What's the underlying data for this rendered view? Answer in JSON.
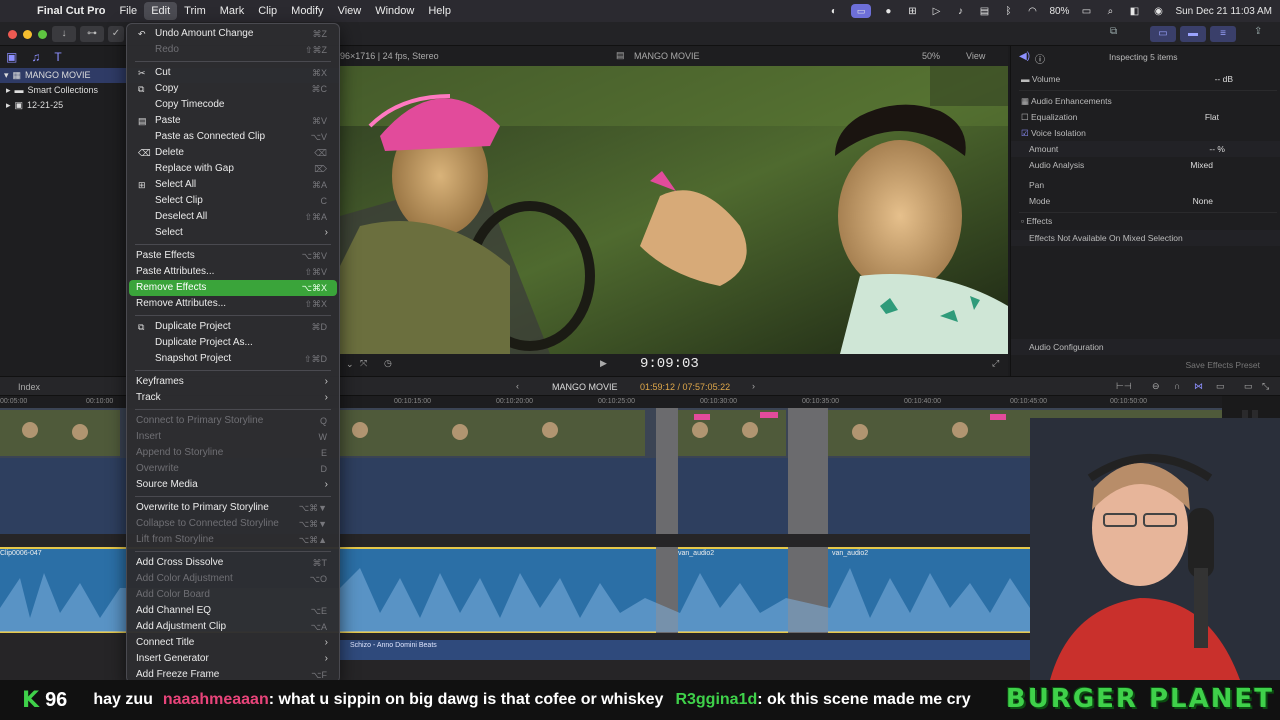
{
  "menubar": {
    "app": "Final Cut Pro",
    "items": [
      "File",
      "Edit",
      "Trim",
      "Mark",
      "Clip",
      "Modify",
      "View",
      "Window",
      "Help"
    ],
    "active_item": "Edit",
    "battery": "80%",
    "datetime": "Sun Dec 21  11:03 AM"
  },
  "browser": {
    "library": "MANGO MOVIE",
    "items": [
      "Smart Collections",
      "12-21-25"
    ]
  },
  "viewer": {
    "format": "96×1716 | 24 fps, Stereo",
    "project": "MANGO MOVIE",
    "zoom": "50%",
    "view": "View",
    "timecode": "9:09:03"
  },
  "inspector": {
    "title": "Inspecting 5 items",
    "volume_label": "Volume",
    "volume_value": "-- dB",
    "enhancements": "Audio Enhancements",
    "equalization": "Equalization",
    "equalization_value": "Flat",
    "voice_isolation": "Voice Isolation",
    "amount": "Amount",
    "amount_value": "-- %",
    "analysis": "Audio Analysis",
    "analysis_value": "Mixed",
    "pan": "Pan",
    "mode": "Mode",
    "mode_value": "None",
    "effects": "Effects",
    "effects_note": "Effects Not Available On Mixed Selection",
    "audio_config": "Audio Configuration",
    "save_preset": "Save Effects Preset"
  },
  "timeline": {
    "index": "Index",
    "project": "MANGO MOVIE",
    "timecode": "01:59:12 / 07:57:05:22",
    "ruler": [
      "00:05:00",
      "00:10:00",
      "00:10:15:00",
      "00:10:20:00",
      "00:10:25:00",
      "00:10:30:00",
      "00:10:35:00",
      "00:10:40:00",
      "00:10:45:00",
      "00:10:50:00"
    ],
    "clip_left": "Clip0006-047",
    "clip_a": "van_audio2",
    "clip_b": "van_audio2",
    "music": "Schizo - Anno Domini Beats"
  },
  "edit_menu": {
    "groups": [
      [
        {
          "label": "Undo Amount Change",
          "shortcut": "⌘Z",
          "icon": "undo",
          "disabled": false
        },
        {
          "label": "Redo",
          "shortcut": "⇧⌘Z",
          "icon": "",
          "disabled": true
        }
      ],
      [
        {
          "label": "Cut",
          "shortcut": "⌘X",
          "icon": "scissors",
          "disabled": false
        },
        {
          "label": "Copy",
          "shortcut": "⌘C",
          "icon": "copy",
          "disabled": false
        },
        {
          "label": "Copy Timecode",
          "shortcut": "",
          "icon": "",
          "disabled": false
        },
        {
          "label": "Paste",
          "shortcut": "⌘V",
          "icon": "paste",
          "disabled": false
        },
        {
          "label": "Paste as Connected Clip",
          "shortcut": "⌥V",
          "icon": "",
          "disabled": false
        },
        {
          "label": "Delete",
          "shortcut": "⌫",
          "icon": "trash",
          "disabled": false
        },
        {
          "label": "Replace with Gap",
          "shortcut": "⌦",
          "icon": "",
          "disabled": false
        },
        {
          "label": "Select All",
          "shortcut": "⌘A",
          "icon": "select-all",
          "disabled": false
        },
        {
          "label": "Select Clip",
          "shortcut": "C",
          "icon": "",
          "disabled": false
        },
        {
          "label": "Deselect All",
          "shortcut": "⇧⌘A",
          "icon": "",
          "disabled": false
        },
        {
          "label": "Select",
          "shortcut": "",
          "icon": "",
          "disabled": false,
          "submenu": true
        }
      ],
      [
        {
          "label": "Paste Effects",
          "shortcut": "⌥⌘V",
          "icon": "",
          "disabled": false,
          "nopad": true
        },
        {
          "label": "Paste Attributes...",
          "shortcut": "⇧⌘V",
          "icon": "",
          "disabled": false,
          "nopad": true
        },
        {
          "label": "Remove Effects",
          "shortcut": "⌥⌘X",
          "icon": "",
          "disabled": false,
          "nopad": true,
          "highlighted": true
        },
        {
          "label": "Remove Attributes...",
          "shortcut": "⇧⌘X",
          "icon": "",
          "disabled": false,
          "nopad": true
        }
      ],
      [
        {
          "label": "Duplicate Project",
          "shortcut": "⌘D",
          "icon": "duplicate",
          "disabled": false
        },
        {
          "label": "Duplicate Project As...",
          "shortcut": "",
          "icon": "",
          "disabled": false
        },
        {
          "label": "Snapshot Project",
          "shortcut": "⇧⌘D",
          "icon": "",
          "disabled": false
        }
      ],
      [
        {
          "label": "Keyframes",
          "shortcut": "",
          "icon": "",
          "disabled": false,
          "nopad": true,
          "submenu": true
        },
        {
          "label": "Track",
          "shortcut": "",
          "icon": "",
          "disabled": false,
          "nopad": true,
          "submenu": true
        }
      ],
      [
        {
          "label": "Connect to Primary Storyline",
          "shortcut": "Q",
          "icon": "",
          "disabled": true,
          "nopad": true
        },
        {
          "label": "Insert",
          "shortcut": "W",
          "icon": "",
          "disabled": true,
          "nopad": true
        },
        {
          "label": "Append to Storyline",
          "shortcut": "E",
          "icon": "",
          "disabled": true,
          "nopad": true
        },
        {
          "label": "Overwrite",
          "shortcut": "D",
          "icon": "",
          "disabled": true,
          "nopad": true
        },
        {
          "label": "Source Media",
          "shortcut": "",
          "icon": "",
          "disabled": false,
          "nopad": true,
          "submenu": true
        }
      ],
      [
        {
          "label": "Overwrite to Primary Storyline",
          "shortcut": "⌥⌘▼",
          "icon": "",
          "disabled": false,
          "nopad": true
        },
        {
          "label": "Collapse to Connected Storyline",
          "shortcut": "⌥⌘▼",
          "icon": "",
          "disabled": true,
          "nopad": true
        },
        {
          "label": "Lift from Storyline",
          "shortcut": "⌥⌘▲",
          "icon": "",
          "disabled": true,
          "nopad": true
        }
      ],
      [
        {
          "label": "Add Cross Dissolve",
          "shortcut": "⌘T",
          "icon": "",
          "disabled": false,
          "nopad": true
        },
        {
          "label": "Add Color Adjustment",
          "shortcut": "⌥O",
          "icon": "",
          "disabled": true,
          "nopad": true
        },
        {
          "label": "Add Color Board",
          "shortcut": "",
          "icon": "",
          "disabled": true,
          "nopad": true
        },
        {
          "label": "Add Channel EQ",
          "shortcut": "⌥E",
          "icon": "",
          "disabled": false,
          "nopad": true
        },
        {
          "label": "Add Adjustment Clip",
          "shortcut": "⌥A",
          "icon": "",
          "disabled": false,
          "nopad": true
        },
        {
          "label": "Connect Title",
          "shortcut": "",
          "icon": "",
          "disabled": false,
          "nopad": true,
          "submenu": true
        },
        {
          "label": "Insert Generator",
          "shortcut": "",
          "icon": "",
          "disabled": false,
          "nopad": true,
          "submenu": true
        },
        {
          "label": "Add Freeze Frame",
          "shortcut": "⌥F",
          "icon": "",
          "disabled": false,
          "nopad": true
        }
      ]
    ]
  },
  "chat": {
    "k": "K",
    "count": "96",
    "line1": "hay zuu",
    "user2": "naaahmeaaan",
    "msg2": ": what u sippin on big dawg is that cofee or whiskey",
    "user3": "R3ggina1d",
    "msg3": ": ok this scene made me cry",
    "brand": "BURGER PLANET"
  }
}
